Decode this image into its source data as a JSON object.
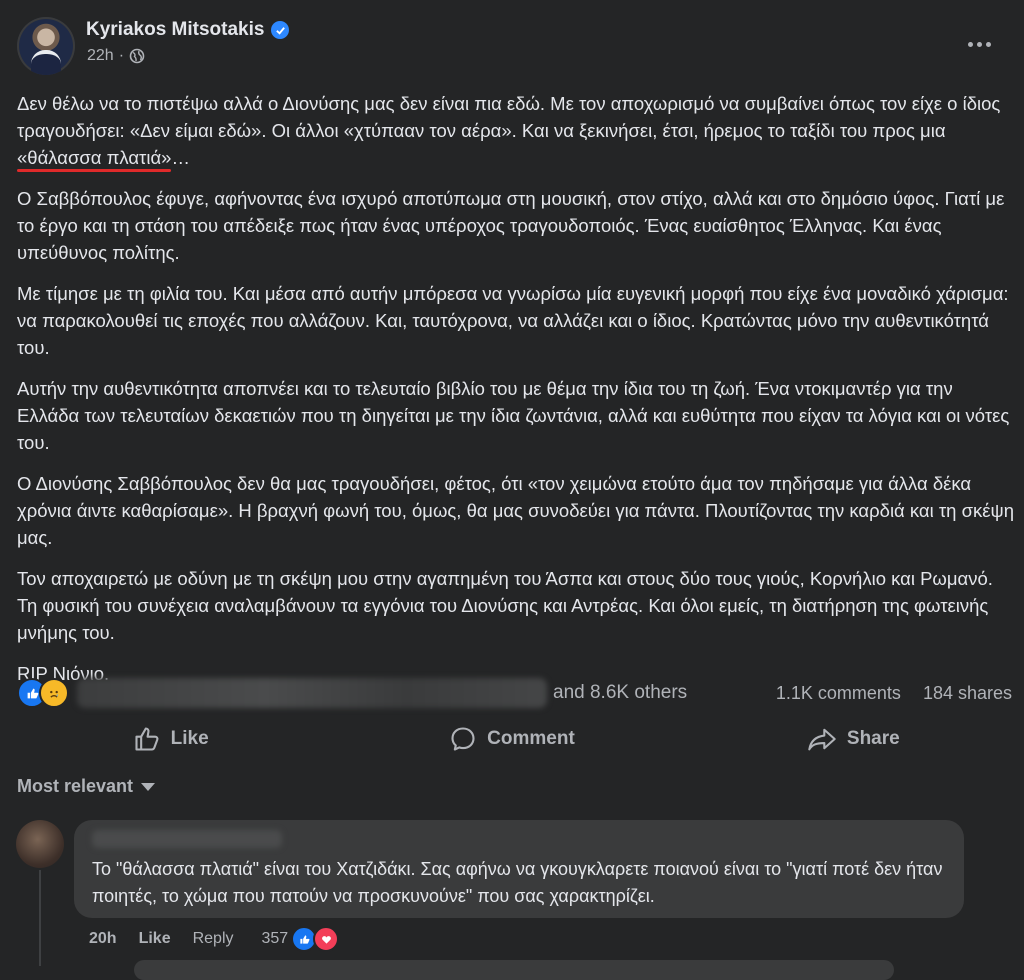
{
  "post": {
    "author": "Kyriakos Mitsotakis",
    "time": "22h",
    "separator": "·",
    "paragraphs": [
      {
        "before": "Δεν θέλω να το πιστέψω αλλά ο Διονύσης μας δεν είναι πια εδώ. Με τον αποχωρισμό να συμβαίνει όπως τον είχε ο ίδιος τραγουδήσει: «Δεν είμαι εδώ». Οι άλλοι «χτύπαan τον αέρα». Και να ξεκινήσει, έτσι, ήρεμος το ταξίδι του προς μια ",
        "highlight": "«θάλασσα πλατιά»",
        "after": "…"
      },
      {
        "text": "Ο Σαββόπουλος έφυγε, αφήνοντας ένα ισχυρό αποτύπωμα στη μουσική, στον στίχο, αλλά και στο δημόσιο ύφος. Γιατί με το έργο και τη στάση του απέδειξε πως ήταν ένας υπέροχος τραγουδοποιός. Ένας ευαίσθητος Έλληνας. Και ένας υπεύθυνος πολίτης."
      },
      {
        "text": "Με τίμησε με τη φιλία του. Και μέσα από αυτήν μπόρεσα να γνωρίσω μία ευγενική μορφή που είχε ένα μοναδικό χάρισμα: να παρακολουθεί τις εποχές που αλλάζουν. Και, ταυτόχρονα, να αλλάζει και ο ίδιος. Κρατώντας μόνο την αυθεντικότητά του."
      },
      {
        "text": "Αυτήν την αυθεντικότητα αποπνέει και το τελευταίο βιβλίο του με θέμα την ίδια του τη ζωή. Ένα ντοκιμαντέρ για την Ελλάδα των τελευταίων δεκαετιών που τη διηγείται με την ίδια ζωντάνια, αλλά και ευθύτητα που είχαν τα λόγια και οι νότες του."
      },
      {
        "text": "Ο Διονύσης Σαββόπουλος δεν θα μας τραγουδήσει, φέτος, ότι «τον χειμώνα ετούτο άμα τον πηδήσαμε για άλλα δέκα χρόνια άιντε καθαρίσαμε». Η βραχνή φωνή του, όμως, θα μας συνοδεύει για πάντα. Πλουτίζοντας την καρδιά και τη σκέψη μας."
      },
      {
        "text": "Τον αποχαιρετώ με οδύνη με τη σκέψη μου στην αγαπημένη του Άσπα και στους δύο τους γιούς, Κορνήλιο και Ρωμανό. Τη φυσική του συνέχεια αναλαμβάνουν τα εγγόνια του Διονύσης και Αντρέας. Και όλοι εμείς, τη διατήρηση της φωτεινής μνήμης του."
      },
      {
        "text": "RIP Νιόνιο."
      }
    ],
    "reactions_others": "and 8.6K others",
    "comments_count": "1.1K comments",
    "shares_count": "184 shares",
    "actions": {
      "like": "Like",
      "comment": "Comment",
      "share": "Share"
    },
    "sort_label": "Most relevant"
  },
  "comment": {
    "text": "Το \"θάλασσα πλατιά\" είναι του Χατζιδάκι. Σας αφήνω να γκουγκλαρετε ποιανού είναι το \"γιατί ποτέ δεν ήταν ποιητές, το χώμα που πατούν να προσκυνούνε\" που σας χαρακτηρίζει.",
    "time": "20h",
    "like": "Like",
    "reply": "Reply",
    "reaction_count": "357"
  },
  "colors": {
    "background": "#242526",
    "bubble": "#3a3b3c",
    "accent": "#2d88ff",
    "underline": "#e02a2a"
  }
}
